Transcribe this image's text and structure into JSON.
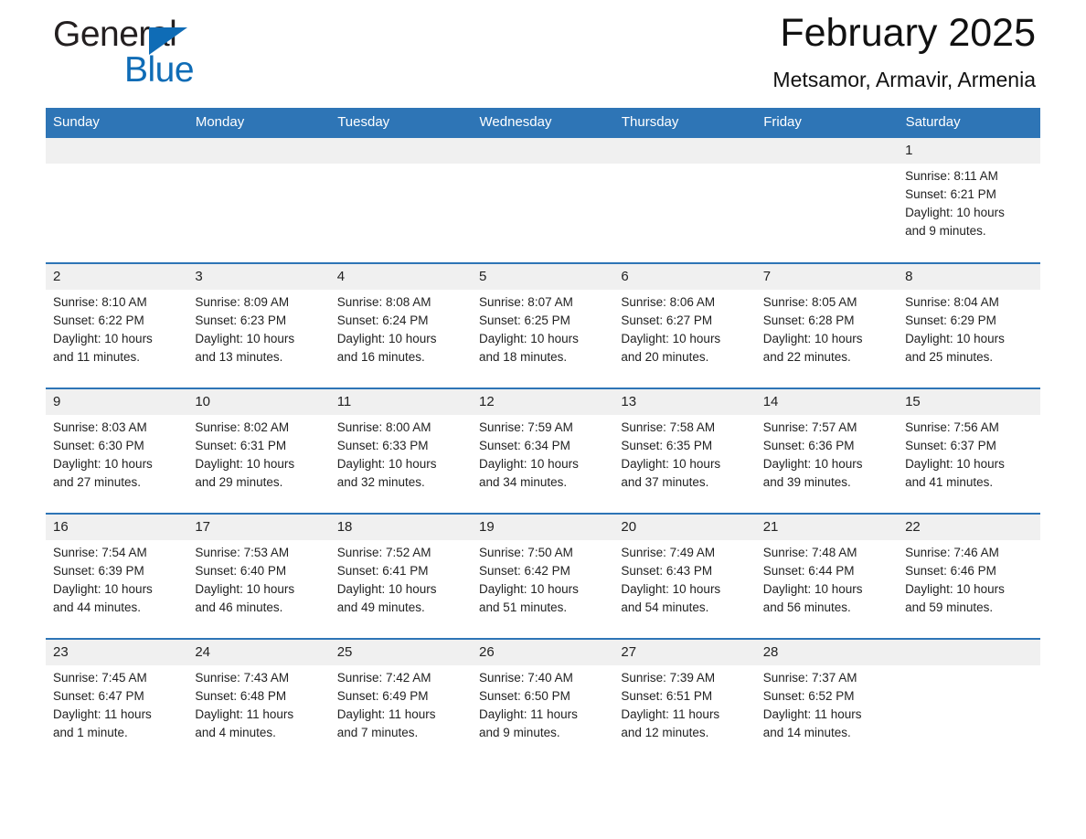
{
  "brand": {
    "name_top": "General",
    "name_bottom": "Blue",
    "color_blue": "#0f6cb6"
  },
  "header": {
    "title": "February 2025",
    "subtitle": "Metsamor, Armavir, Armenia"
  },
  "theme": {
    "header_blue": "#2e75b6",
    "daynum_gray": "#f0f0f0"
  },
  "weekdays": [
    "Sunday",
    "Monday",
    "Tuesday",
    "Wednesday",
    "Thursday",
    "Friday",
    "Saturday"
  ],
  "weeks": [
    [
      {
        "day": "",
        "sunrise": "",
        "sunset": "",
        "daylight_1": "",
        "daylight_2": ""
      },
      {
        "day": "",
        "sunrise": "",
        "sunset": "",
        "daylight_1": "",
        "daylight_2": ""
      },
      {
        "day": "",
        "sunrise": "",
        "sunset": "",
        "daylight_1": "",
        "daylight_2": ""
      },
      {
        "day": "",
        "sunrise": "",
        "sunset": "",
        "daylight_1": "",
        "daylight_2": ""
      },
      {
        "day": "",
        "sunrise": "",
        "sunset": "",
        "daylight_1": "",
        "daylight_2": ""
      },
      {
        "day": "",
        "sunrise": "",
        "sunset": "",
        "daylight_1": "",
        "daylight_2": ""
      },
      {
        "day": "1",
        "sunrise": "Sunrise: 8:11 AM",
        "sunset": "Sunset: 6:21 PM",
        "daylight_1": "Daylight: 10 hours",
        "daylight_2": "and 9 minutes."
      }
    ],
    [
      {
        "day": "2",
        "sunrise": "Sunrise: 8:10 AM",
        "sunset": "Sunset: 6:22 PM",
        "daylight_1": "Daylight: 10 hours",
        "daylight_2": "and 11 minutes."
      },
      {
        "day": "3",
        "sunrise": "Sunrise: 8:09 AM",
        "sunset": "Sunset: 6:23 PM",
        "daylight_1": "Daylight: 10 hours",
        "daylight_2": "and 13 minutes."
      },
      {
        "day": "4",
        "sunrise": "Sunrise: 8:08 AM",
        "sunset": "Sunset: 6:24 PM",
        "daylight_1": "Daylight: 10 hours",
        "daylight_2": "and 16 minutes."
      },
      {
        "day": "5",
        "sunrise": "Sunrise: 8:07 AM",
        "sunset": "Sunset: 6:25 PM",
        "daylight_1": "Daylight: 10 hours",
        "daylight_2": "and 18 minutes."
      },
      {
        "day": "6",
        "sunrise": "Sunrise: 8:06 AM",
        "sunset": "Sunset: 6:27 PM",
        "daylight_1": "Daylight: 10 hours",
        "daylight_2": "and 20 minutes."
      },
      {
        "day": "7",
        "sunrise": "Sunrise: 8:05 AM",
        "sunset": "Sunset: 6:28 PM",
        "daylight_1": "Daylight: 10 hours",
        "daylight_2": "and 22 minutes."
      },
      {
        "day": "8",
        "sunrise": "Sunrise: 8:04 AM",
        "sunset": "Sunset: 6:29 PM",
        "daylight_1": "Daylight: 10 hours",
        "daylight_2": "and 25 minutes."
      }
    ],
    [
      {
        "day": "9",
        "sunrise": "Sunrise: 8:03 AM",
        "sunset": "Sunset: 6:30 PM",
        "daylight_1": "Daylight: 10 hours",
        "daylight_2": "and 27 minutes."
      },
      {
        "day": "10",
        "sunrise": "Sunrise: 8:02 AM",
        "sunset": "Sunset: 6:31 PM",
        "daylight_1": "Daylight: 10 hours",
        "daylight_2": "and 29 minutes."
      },
      {
        "day": "11",
        "sunrise": "Sunrise: 8:00 AM",
        "sunset": "Sunset: 6:33 PM",
        "daylight_1": "Daylight: 10 hours",
        "daylight_2": "and 32 minutes."
      },
      {
        "day": "12",
        "sunrise": "Sunrise: 7:59 AM",
        "sunset": "Sunset: 6:34 PM",
        "daylight_1": "Daylight: 10 hours",
        "daylight_2": "and 34 minutes."
      },
      {
        "day": "13",
        "sunrise": "Sunrise: 7:58 AM",
        "sunset": "Sunset: 6:35 PM",
        "daylight_1": "Daylight: 10 hours",
        "daylight_2": "and 37 minutes."
      },
      {
        "day": "14",
        "sunrise": "Sunrise: 7:57 AM",
        "sunset": "Sunset: 6:36 PM",
        "daylight_1": "Daylight: 10 hours",
        "daylight_2": "and 39 minutes."
      },
      {
        "day": "15",
        "sunrise": "Sunrise: 7:56 AM",
        "sunset": "Sunset: 6:37 PM",
        "daylight_1": "Daylight: 10 hours",
        "daylight_2": "and 41 minutes."
      }
    ],
    [
      {
        "day": "16",
        "sunrise": "Sunrise: 7:54 AM",
        "sunset": "Sunset: 6:39 PM",
        "daylight_1": "Daylight: 10 hours",
        "daylight_2": "and 44 minutes."
      },
      {
        "day": "17",
        "sunrise": "Sunrise: 7:53 AM",
        "sunset": "Sunset: 6:40 PM",
        "daylight_1": "Daylight: 10 hours",
        "daylight_2": "and 46 minutes."
      },
      {
        "day": "18",
        "sunrise": "Sunrise: 7:52 AM",
        "sunset": "Sunset: 6:41 PM",
        "daylight_1": "Daylight: 10 hours",
        "daylight_2": "and 49 minutes."
      },
      {
        "day": "19",
        "sunrise": "Sunrise: 7:50 AM",
        "sunset": "Sunset: 6:42 PM",
        "daylight_1": "Daylight: 10 hours",
        "daylight_2": "and 51 minutes."
      },
      {
        "day": "20",
        "sunrise": "Sunrise: 7:49 AM",
        "sunset": "Sunset: 6:43 PM",
        "daylight_1": "Daylight: 10 hours",
        "daylight_2": "and 54 minutes."
      },
      {
        "day": "21",
        "sunrise": "Sunrise: 7:48 AM",
        "sunset": "Sunset: 6:44 PM",
        "daylight_1": "Daylight: 10 hours",
        "daylight_2": "and 56 minutes."
      },
      {
        "day": "22",
        "sunrise": "Sunrise: 7:46 AM",
        "sunset": "Sunset: 6:46 PM",
        "daylight_1": "Daylight: 10 hours",
        "daylight_2": "and 59 minutes."
      }
    ],
    [
      {
        "day": "23",
        "sunrise": "Sunrise: 7:45 AM",
        "sunset": "Sunset: 6:47 PM",
        "daylight_1": "Daylight: 11 hours",
        "daylight_2": "and 1 minute."
      },
      {
        "day": "24",
        "sunrise": "Sunrise: 7:43 AM",
        "sunset": "Sunset: 6:48 PM",
        "daylight_1": "Daylight: 11 hours",
        "daylight_2": "and 4 minutes."
      },
      {
        "day": "25",
        "sunrise": "Sunrise: 7:42 AM",
        "sunset": "Sunset: 6:49 PM",
        "daylight_1": "Daylight: 11 hours",
        "daylight_2": "and 7 minutes."
      },
      {
        "day": "26",
        "sunrise": "Sunrise: 7:40 AM",
        "sunset": "Sunset: 6:50 PM",
        "daylight_1": "Daylight: 11 hours",
        "daylight_2": "and 9 minutes."
      },
      {
        "day": "27",
        "sunrise": "Sunrise: 7:39 AM",
        "sunset": "Sunset: 6:51 PM",
        "daylight_1": "Daylight: 11 hours",
        "daylight_2": "and 12 minutes."
      },
      {
        "day": "28",
        "sunrise": "Sunrise: 7:37 AM",
        "sunset": "Sunset: 6:52 PM",
        "daylight_1": "Daylight: 11 hours",
        "daylight_2": "and 14 minutes."
      },
      {
        "day": "",
        "sunrise": "",
        "sunset": "",
        "daylight_1": "",
        "daylight_2": ""
      }
    ]
  ]
}
